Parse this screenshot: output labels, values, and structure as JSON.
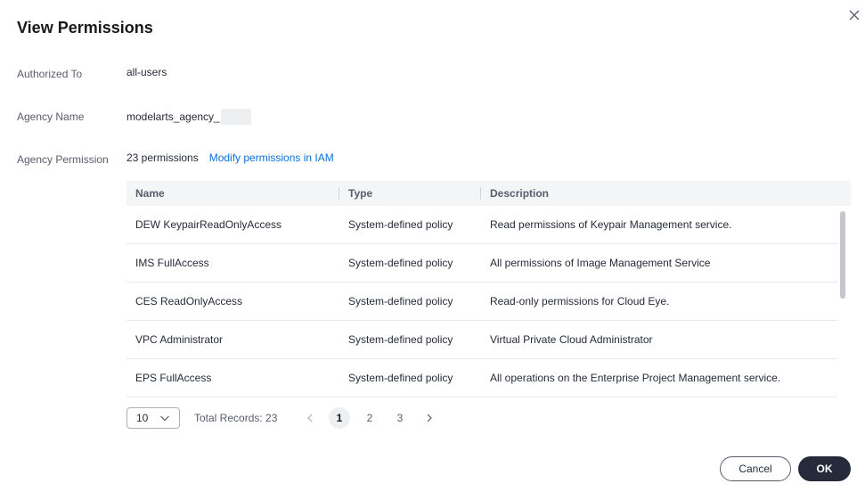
{
  "dialog": {
    "title": "View Permissions",
    "close_icon": "close-icon"
  },
  "fields": {
    "authorized_to": {
      "label": "Authorized To",
      "value": "all-users"
    },
    "agency_name": {
      "label": "Agency Name",
      "value": "modelarts_agency_"
    },
    "agency_permission": {
      "label": "Agency Permission",
      "count_text": "23 permissions",
      "link_text": "Modify permissions in IAM"
    }
  },
  "table": {
    "columns": [
      "Name",
      "Type",
      "Description"
    ],
    "rows": [
      {
        "name": "DEW KeypairReadOnlyAccess",
        "type": "System-defined policy",
        "description": "Read permissions of Keypair Management service."
      },
      {
        "name": "IMS FullAccess",
        "type": "System-defined policy",
        "description": "All permissions of Image Management Service"
      },
      {
        "name": "CES ReadOnlyAccess",
        "type": "System-defined policy",
        "description": "Read-only permissions for Cloud Eye."
      },
      {
        "name": "VPC Administrator",
        "type": "System-defined policy",
        "description": "Virtual Private Cloud Administrator"
      },
      {
        "name": "EPS FullAccess",
        "type": "System-defined policy",
        "description": "All operations on the Enterprise Project Management service."
      }
    ]
  },
  "pagination": {
    "page_size": "10",
    "total_text": "Total Records: 23",
    "pages": [
      "1",
      "2",
      "3"
    ],
    "current_page": "1"
  },
  "footer": {
    "cancel_label": "Cancel",
    "ok_label": "OK"
  },
  "colors": {
    "link": "#0b70d8",
    "primary_button": "#252b3a",
    "header_bg": "#f4f5f6"
  }
}
